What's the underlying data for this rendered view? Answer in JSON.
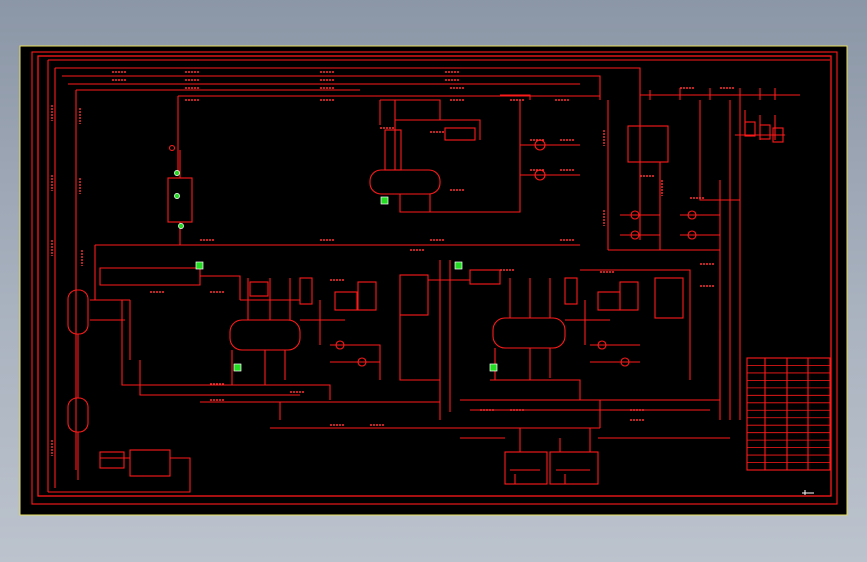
{
  "colors": {
    "background": "#000000",
    "line": "#ff1a1a",
    "highlight": "#22dd22",
    "outer_frame": "#e8e060"
  },
  "drawing": {
    "title_block_caption": "",
    "title_block_rows": 15
  }
}
